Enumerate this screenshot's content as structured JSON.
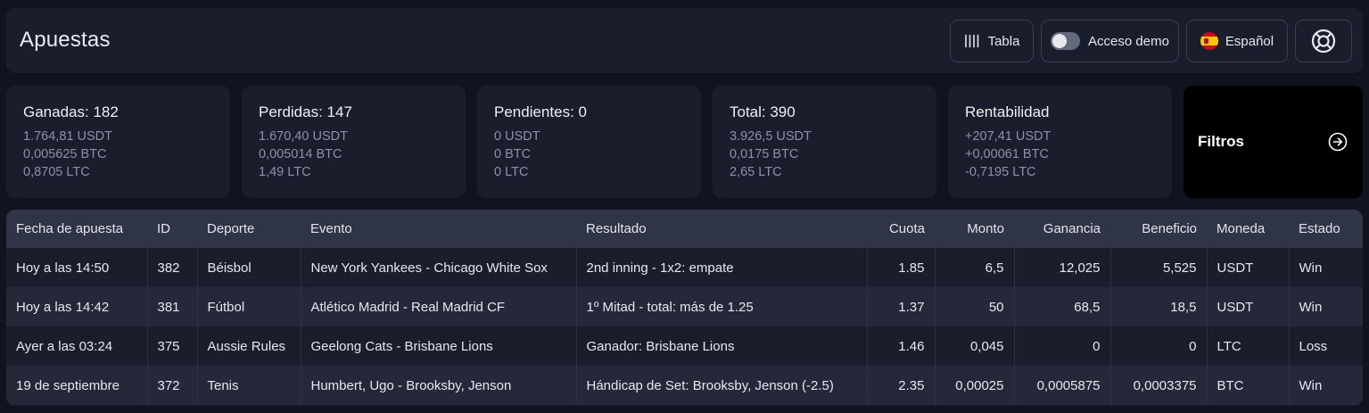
{
  "header": {
    "title": "Apuestas",
    "tabla_label": "Tabla",
    "demo_label": "Acceso demo",
    "language_label": "Español"
  },
  "stats": [
    {
      "label": "Ganadas: 182",
      "usdt": "1.764,81 USDT",
      "btc": "0,005625 BTC",
      "ltc": "0,8705 LTC"
    },
    {
      "label": "Perdidas: 147",
      "usdt": "1.670,40 USDT",
      "btc": "0,005014 BTC",
      "ltc": "1,49 LTC"
    },
    {
      "label": "Pendientes: 0",
      "usdt": "0 USDT",
      "btc": "0 BTC",
      "ltc": "0 LTC"
    },
    {
      "label": "Total: 390",
      "usdt": "3.926,5 USDT",
      "btc": "0,0175 BTC",
      "ltc": "2,65 LTC"
    },
    {
      "label": "Rentabilidad",
      "usdt": "+207,41 USDT",
      "btc": "+0,00061 BTC",
      "ltc": "-0,7195 LTC"
    }
  ],
  "filters_label": "Filtros",
  "table": {
    "columns": [
      "Fecha de apuesta",
      "ID",
      "Deporte",
      "Evento",
      "Resultado",
      "Cuota",
      "Monto",
      "Ganancia",
      "Beneficio",
      "Moneda",
      "Estado"
    ],
    "rows": [
      {
        "fecha": "Hoy a las 14:50",
        "id": "382",
        "deporte": "Béisbol",
        "evento": "New York Yankees - Chicago White Sox",
        "resultado": "2nd inning - 1x2: empate",
        "cuota": "1.85",
        "monto": "6,5",
        "ganancia": "12,025",
        "beneficio": "5,525",
        "moneda": "USDT",
        "estado": "Win"
      },
      {
        "fecha": "Hoy a las 14:42",
        "id": "381",
        "deporte": "Fútbol",
        "evento": "Atlético Madrid - Real Madrid CF",
        "resultado": "1º Mitad - total: más de 1.25",
        "cuota": "1.37",
        "monto": "50",
        "ganancia": "68,5",
        "beneficio": "18,5",
        "moneda": "USDT",
        "estado": "Win"
      },
      {
        "fecha": "Ayer a las 03:24",
        "id": "375",
        "deporte": "Aussie Rules",
        "evento": "Geelong Cats - Brisbane Lions",
        "resultado": "Ganador: Brisbane Lions",
        "cuota": "1.46",
        "monto": "0,045",
        "ganancia": "0",
        "beneficio": "0",
        "moneda": "LTC",
        "estado": "Loss"
      },
      {
        "fecha": "19 de septiembre",
        "id": "372",
        "deporte": "Tenis",
        "evento": "Humbert, Ugo - Brooksby, Jenson",
        "resultado": "Hándicap de Set: Brooksby, Jenson (-2.5)",
        "cuota": "2.35",
        "monto": "0,00025",
        "ganancia": "0,0005875",
        "beneficio": "0,0003375",
        "moneda": "BTC",
        "estado": "Win"
      }
    ]
  }
}
